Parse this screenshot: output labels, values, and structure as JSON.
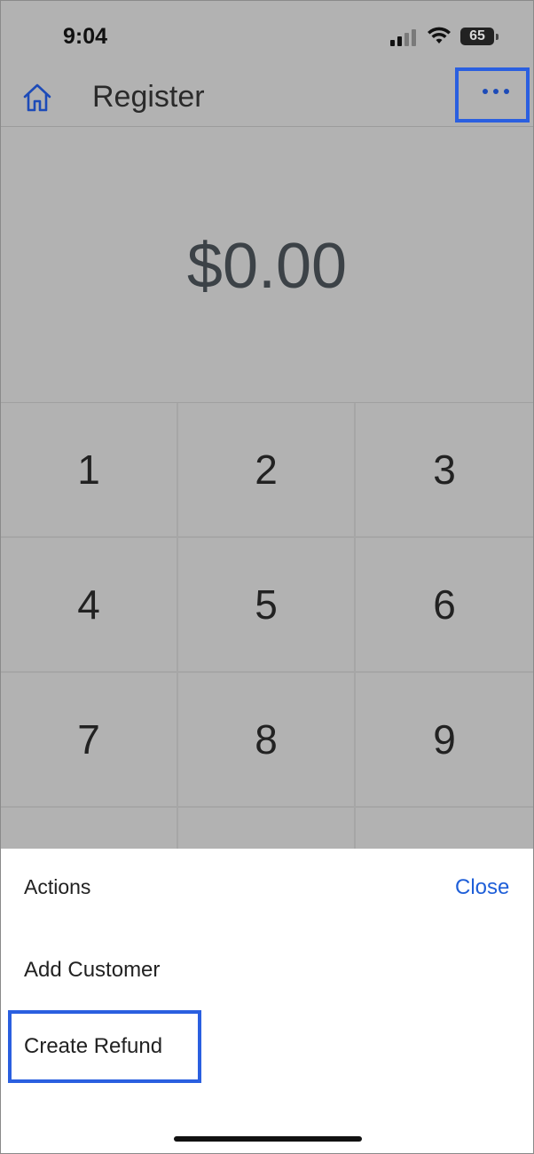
{
  "status_bar": {
    "time": "9:04",
    "battery": "65",
    "icons": [
      "cellular-signal-icon",
      "wifi-icon",
      "battery-icon"
    ]
  },
  "navbar": {
    "title": "Register",
    "home_icon": "home-icon",
    "more_icon": "ellipsis-icon"
  },
  "display": {
    "amount": "$0.00"
  },
  "keypad": {
    "keys": [
      "1",
      "2",
      "3",
      "4",
      "5",
      "6",
      "7",
      "8",
      "9"
    ]
  },
  "action_sheet": {
    "title": "Actions",
    "close_label": "Close",
    "items": [
      {
        "label": "Add Customer"
      },
      {
        "label": "Create Refund"
      }
    ]
  },
  "colors": {
    "accent": "#1f5fd8",
    "highlight_border": "#2a5fe0",
    "dim_overlay": "#b2b2b2"
  }
}
